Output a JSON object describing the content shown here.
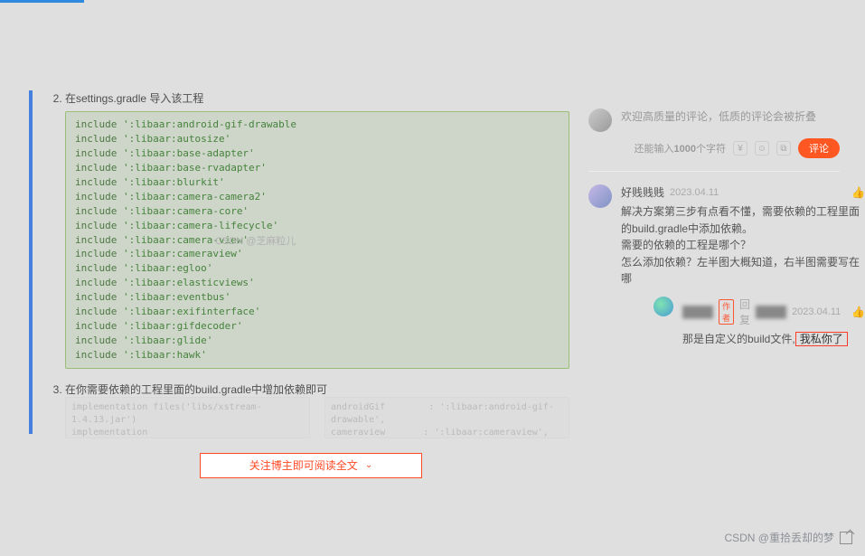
{
  "article": {
    "step2_title": "在settings.gradle 导入该工程",
    "code_lines": [
      "include ':libaar:android-gif-drawable",
      "include ':libaar:autosize'",
      "include ':libaar:base-adapter'",
      "include ':libaar:base-rvadapter'",
      "include ':libaar:blurkit'",
      "include ':libaar:camera-camera2'",
      "include ':libaar:camera-core'",
      "include ':libaar:camera-lifecycle'",
      "include ':libaar:camera-view'",
      "include ':libaar:cameraview'",
      "include ':libaar:egloo'",
      "include ':libaar:elasticviews'",
      "include ':libaar:eventbus'",
      "include ':libaar:exifinterface'",
      "include ':libaar:gifdecoder'",
      "include ':libaar:glide'",
      "include ':libaar:hawk'"
    ],
    "step3_title": "在你需要依赖的工程里面的build.gradle中增加依赖即可",
    "faded_left": "implementation files('libs/xstream-1.4.13.jar')\nimplementation project(path:rootProject.ext.ver[\"autosize\"])\nimplementation project(path:rootProject.ext.ver[\"XXPermissions\"])",
    "faded_right": "androidGif        : ':libaar:android-gif-drawable',\ncameraview       : ':libaar:cameraview',\nglidedecoder     : ':libaar:gifdecoder',",
    "watermark": "CSDN @芝麻粒儿",
    "expand_btn": "关注博主即可阅读全文"
  },
  "sidebar": {
    "comment_placeholder": "欢迎高质量的评论，低质的评论会被折叠",
    "counter_prefix": "还能输入",
    "counter_count": "1000",
    "counter_suffix": "个字符",
    "publish_label": "评论"
  },
  "comments": [
    {
      "name": "好贱贱贱",
      "date": "2023.04.11",
      "text1": "解决方案第三步有点看不懂，需要依赖的工程里面的build.gradle中添加依赖。",
      "text2": "需要的依赖的工程是哪个？",
      "text3": "怎么添加依赖？左半图大概知道，右半图需要写在哪"
    }
  ],
  "reply": {
    "tag": "作者",
    "action": "回复",
    "target": "好贱贱贱",
    "date": "2023.04.11",
    "text_prefix": "那是自定义的build文件,",
    "highlight": "我私你了"
  },
  "footer_watermark": "CSDN @重拾丢却的梦"
}
